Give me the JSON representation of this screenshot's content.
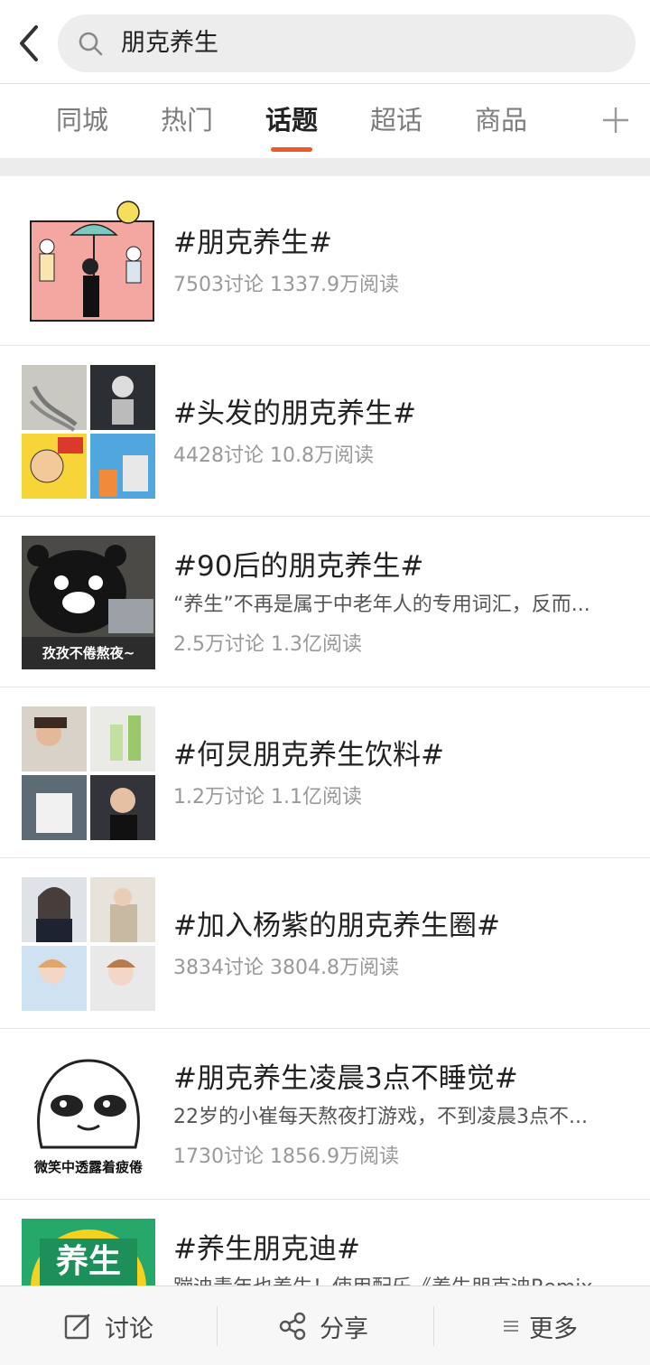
{
  "search": {
    "query": "朋克养生"
  },
  "tabs": [
    {
      "label": "同城",
      "active": false
    },
    {
      "label": "热门",
      "active": false
    },
    {
      "label": "话题",
      "active": true
    },
    {
      "label": "超话",
      "active": false
    },
    {
      "label": "商品",
      "active": false
    }
  ],
  "colors": {
    "accent": "#ee5a24",
    "background_band": "#ececec",
    "title_text": "#222222",
    "stats_text": "#999999"
  },
  "topics": [
    {
      "title": "#朋克养生#",
      "desc": "",
      "stats": "7503讨论 1337.9万阅读",
      "thumb_icon": "cartoon-girls-umbrella-image"
    },
    {
      "title": "#头发的朋克养生#",
      "desc": "",
      "stats": "4428讨论 10.8万阅读",
      "thumb_icon": "hair-loss-collage-image"
    },
    {
      "title": "#90后的朋克养生#",
      "desc": "“养生”不再是属于中老年人的专用词汇，反而...",
      "stats": "2.5万讨论 1.3亿阅读",
      "thumb_icon": "kumamon-image",
      "thumb_caption": "孜孜不倦熬夜~"
    },
    {
      "title": "#何炅朋克养生饮料#",
      "desc": "",
      "stats": "1.2万讨论 1.1亿阅读",
      "thumb_icon": "drink-photo-collage-image"
    },
    {
      "title": "#加入杨紫的朋克养生圈#",
      "desc": "",
      "stats": "3834讨论 3804.8万阅读",
      "thumb_icon": "actress-photo-collage-image"
    },
    {
      "title": "#朋克养生凌晨3点不睡觉#",
      "desc": "22岁的小崔每天熬夜打游戏，不到凌晨3点不...",
      "stats": "1730讨论 1856.9万阅读",
      "thumb_icon": "tired-smile-meme-image",
      "thumb_caption": "微笑中透露着疲倦"
    },
    {
      "title": "#养生朋克迪#",
      "desc": "蹦迪青年也养生！使用配乐《养生朋克迪Remix",
      "stats": "",
      "thumb_icon": "yangsheng-logo-image",
      "thumb_caption": "养生"
    }
  ],
  "bottom_bar": {
    "discuss_label": "讨论",
    "share_label": "分享",
    "more_label": "更多"
  }
}
